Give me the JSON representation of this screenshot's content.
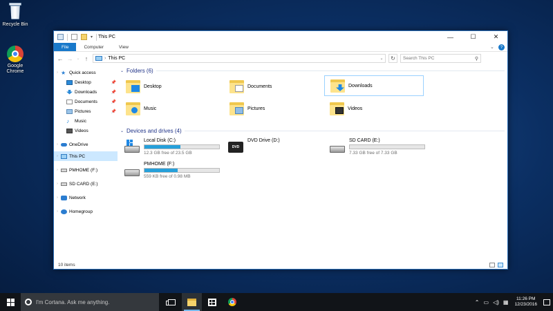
{
  "desktop": {
    "icons": [
      {
        "label": "Recycle Bin"
      },
      {
        "label": "Google Chrome"
      }
    ]
  },
  "window": {
    "title": "This PC",
    "controls": {
      "minimize": "—",
      "maximize": "☐",
      "close": "✕"
    },
    "ribbon": {
      "tabs": [
        "File",
        "Computer",
        "View"
      ],
      "expand_glyph": "⌄",
      "help_glyph": "?"
    },
    "address": {
      "path": "This PC",
      "search_placeholder": "Search This PC"
    },
    "sidebar": {
      "quick_access": "Quick access",
      "quick_items": [
        {
          "label": "Desktop",
          "pinned": true,
          "icon": "desktop-icon"
        },
        {
          "label": "Downloads",
          "pinned": true,
          "icon": "downloads-icon"
        },
        {
          "label": "Documents",
          "pinned": true,
          "icon": "documents-icon"
        },
        {
          "label": "Pictures",
          "pinned": true,
          "icon": "pictures-icon"
        },
        {
          "label": "Music",
          "pinned": false,
          "icon": "music-icon"
        },
        {
          "label": "Videos",
          "pinned": false,
          "icon": "videos-icon"
        }
      ],
      "onedrive": "OneDrive",
      "this_pc": "This PC",
      "pmhome": "PMHOME (F:)",
      "sd_card": "SD CARD (E:)",
      "network": "Network",
      "homegroup": "Homegroup"
    },
    "folders_group": {
      "heading": "Folders (6)",
      "items": [
        "Desktop",
        "Documents",
        "Downloads",
        "Music",
        "Pictures",
        "Videos"
      ]
    },
    "drives_group": {
      "heading": "Devices and drives (4)",
      "local_disk": {
        "name": "Local Disk (C:)",
        "free": "12.3 GB free of 23.5 GB",
        "used_fraction": 0.48
      },
      "dvd": {
        "name": "DVD Drive (D:)",
        "badge": "DVD"
      },
      "sd_card": {
        "name": "SD CARD (E:)",
        "free": "7.33 GB free of 7.33 GB",
        "used_fraction": 0.0
      },
      "pmhome": {
        "name": "PMHOME (F:)",
        "free": "559 KB free of 0.98 MB",
        "used_fraction": 0.44
      }
    },
    "status": {
      "item_count": "10 items"
    }
  },
  "taskbar": {
    "cortana_placeholder": "I'm Cortana. Ask me anything.",
    "clock_time": "11:26 PM",
    "clock_date": "12/23/2016"
  },
  "colors": {
    "accent": "#1979ca",
    "drive_bar": "#26a0da",
    "selection": "#cce8ff"
  }
}
